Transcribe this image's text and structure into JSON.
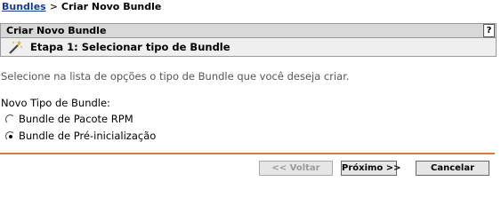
{
  "breadcrumb": {
    "parent": "Bundles",
    "separator": ">",
    "current": "Criar Novo Bundle"
  },
  "panel": {
    "title": "Criar Novo Bundle",
    "help_label": "?"
  },
  "step": {
    "icon": "wizard-wand-icon",
    "title": "Etapa 1: Selecionar tipo de Bundle"
  },
  "instructions": "Selecione na lista de opções o tipo de Bundle que você deseja criar.",
  "bundle_type": {
    "label": "Novo Tipo de Bundle:",
    "options": [
      {
        "label": "Bundle de Pacote RPM",
        "selected": false
      },
      {
        "label": "Bundle de Pré-inicialização",
        "selected": true
      }
    ]
  },
  "buttons": {
    "back": "<< Voltar",
    "next": "Próximo >>",
    "cancel": "Cancelar"
  },
  "colors": {
    "divider": "#d97a3a",
    "link": "#1a3a8c"
  }
}
